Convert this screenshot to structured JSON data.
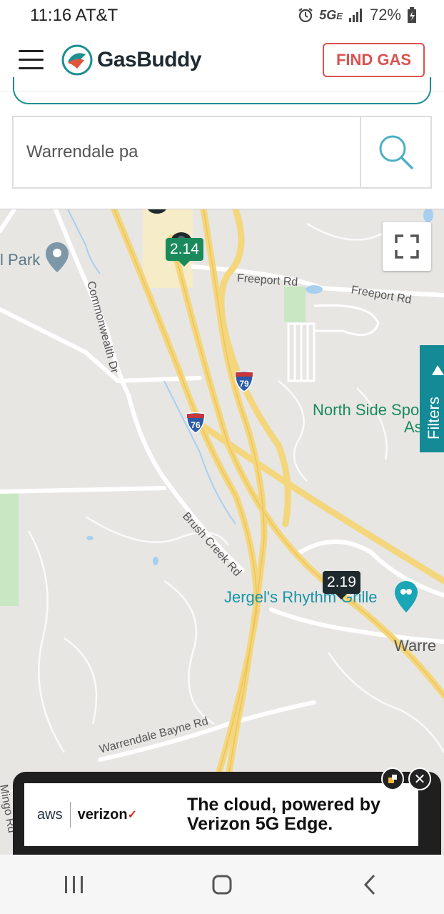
{
  "status_bar": {
    "time_carrier": "11:16 AT&T",
    "network": "5G",
    "network_sub": "E",
    "battery": "72%",
    "icons": [
      "alarm-icon",
      "signal-icon",
      "battery-icon"
    ]
  },
  "header": {
    "logo_text": "GasBuddy",
    "find_gas_label": "FIND GAS",
    "accent_color": "#d9534f",
    "brand_teal": "#1c8f91"
  },
  "search": {
    "value": "Warrendale pa"
  },
  "map": {
    "road_labels": {
      "park": "l Park",
      "commonwealth": "Commonwealth Dr",
      "freeport1": "Freeport Rd",
      "freeport2": "Freeport Rd",
      "brush_creek": "Brush Creek Rd",
      "warrendale_bayne": "Warrendale Bayne Rd",
      "mingo": "Mingo Rd",
      "warren": "Warre"
    },
    "poi": {
      "north_side_line1": "North Side Spo",
      "north_side_line2": "As",
      "jergels": "Jergel's Rhythm Grille"
    },
    "highways": {
      "i79": "79",
      "i76": "76"
    },
    "price_pins": [
      {
        "price": "2.14",
        "color": "green"
      },
      {
        "price": "2.19",
        "color": "dark"
      }
    ],
    "filters_label": "Filters"
  },
  "ad": {
    "brand_aws": "aws",
    "brand_verizon": "verizon",
    "headline": "The cloud, powered by Verizon 5G Edge."
  },
  "nav": {
    "icons": [
      "recents-icon",
      "home-icon",
      "back-icon"
    ]
  }
}
